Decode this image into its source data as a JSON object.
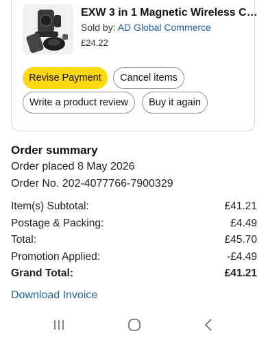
{
  "product": {
    "title": "EXW 3 in 1 Magnetic Wireless Ch...",
    "sold_by_label": "Sold by:",
    "seller": "AD Global Commerce",
    "price": "£24.22",
    "image_icon": "wireless-charger-image"
  },
  "actions": {
    "revise_payment": "Revise Payment",
    "cancel_items": "Cancel items",
    "write_review": "Write a product review",
    "buy_again": "Buy it again"
  },
  "summary": {
    "heading": "Order summary",
    "placed": "Order placed 8 May 2026",
    "order_no": "Order No. 202-4077766-7900329",
    "rows": [
      {
        "label": "Item(s) Subtotal:",
        "value": "£41.21"
      },
      {
        "label": "Postage & Packing:",
        "value": "£4.49"
      },
      {
        "label": "Total:",
        "value": "£45.70"
      },
      {
        "label": "Promotion Applied:",
        "value": "-£4.49"
      },
      {
        "label": "Grand Total:",
        "value": "£41.21"
      }
    ],
    "download_invoice": "Download Invoice"
  },
  "navbar": {
    "recents_icon": "recents-icon",
    "home_icon": "home-icon",
    "back_icon": "back-icon"
  },
  "colors": {
    "primary_button": "#ffd814",
    "link": "#2162a1"
  }
}
